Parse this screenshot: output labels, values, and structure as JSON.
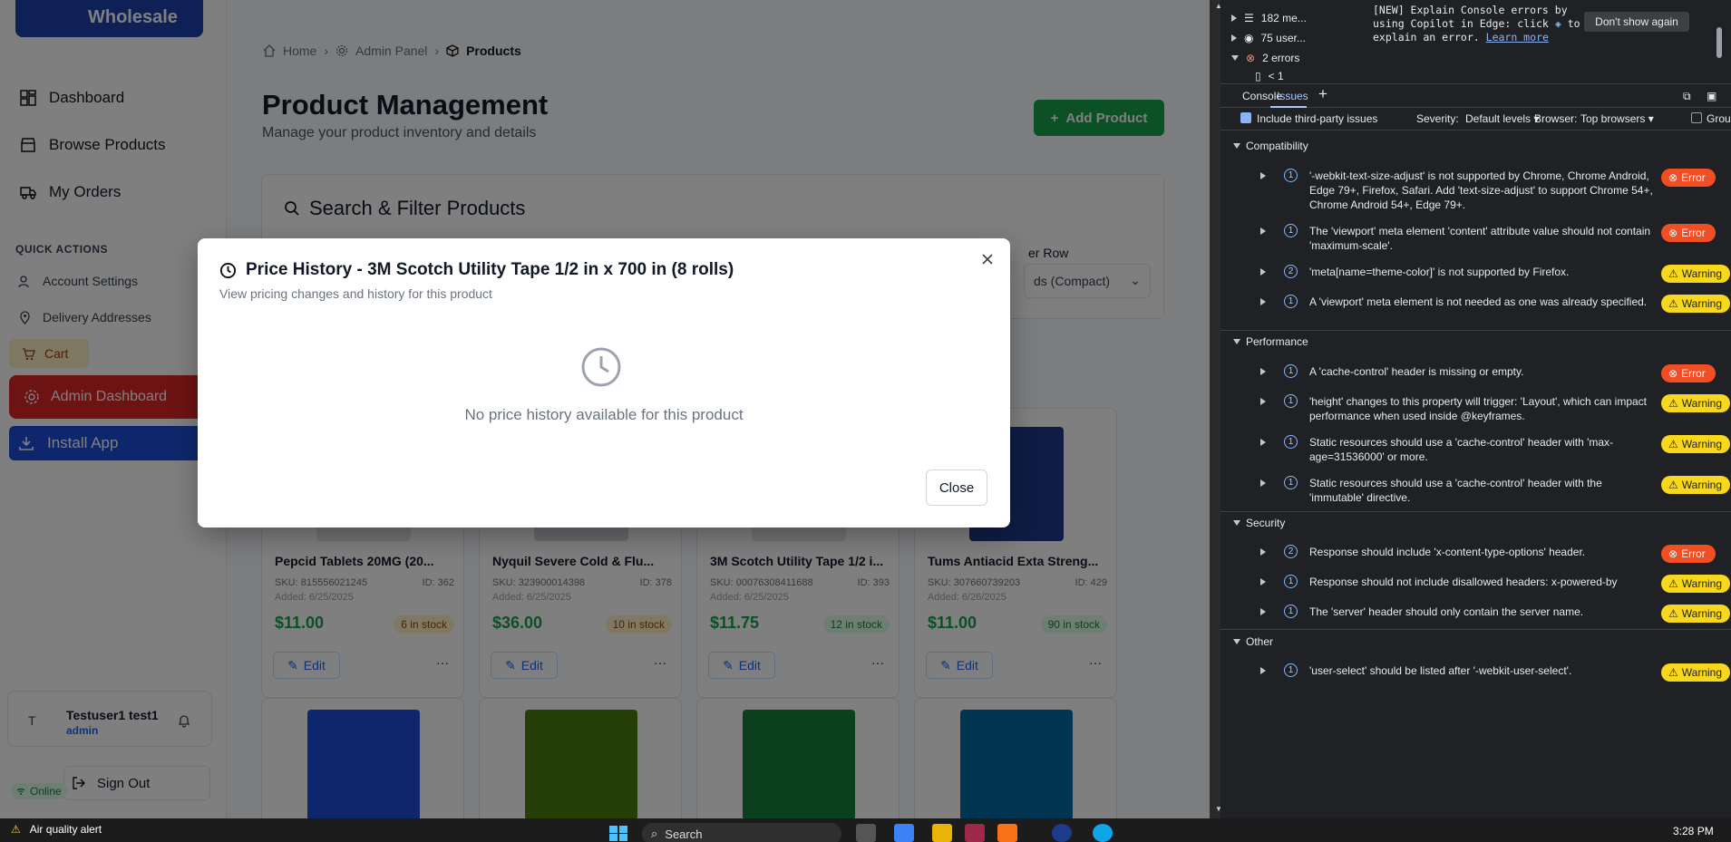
{
  "sidebar": {
    "brand": "Wholesale",
    "nav": [
      {
        "label": "Dashboard",
        "icon": "dashboard-icon"
      },
      {
        "label": "Browse Products",
        "icon": "store-icon"
      },
      {
        "label": "My Orders",
        "icon": "truck-icon"
      }
    ],
    "quick_actions_label": "QUICK ACTIONS",
    "quick_actions": [
      {
        "label": "Account Settings",
        "icon": "user-settings-icon"
      },
      {
        "label": "Delivery Addresses",
        "icon": "map-pin-icon"
      }
    ],
    "cart_label": "Cart",
    "admin_label": "Admin Dashboard",
    "install_label": "Install App",
    "user": {
      "initial": "T",
      "name": "Testuser1 test1",
      "role": "admin"
    },
    "online_label": "Online",
    "signout_label": "Sign Out"
  },
  "breadcrumb": {
    "home": "Home",
    "admin": "Admin Panel",
    "current": "Products"
  },
  "page": {
    "title": "Product Management",
    "subtitle": "Manage your product inventory and details",
    "add_button": "Add Product",
    "filter_title": "Search & Filter Products",
    "per_row_label": "er Row",
    "per_row_value": "ds (Compact)"
  },
  "products": [
    {
      "name": "Pepcid Tablets 20MG (20...",
      "sku": "SKU: 815556021245",
      "id": "ID: 362",
      "added": "Added: 6/25/2025",
      "price": "$11.00",
      "stock": "6 in stock",
      "stock_kind": "low"
    },
    {
      "name": "Nyquil Severe Cold & Flu...",
      "sku": "SKU: 323900014398",
      "id": "ID: 378",
      "added": "Added: 6/25/2025",
      "price": "$36.00",
      "stock": "10 in stock",
      "stock_kind": "low"
    },
    {
      "name": "3M Scotch Utility Tape 1/2 i...",
      "sku": "SKU: 00076308411688",
      "id": "ID: 393",
      "added": "Added: 6/25/2025",
      "price": "$11.75",
      "stock": "12 in stock",
      "stock_kind": "ok"
    },
    {
      "name": "Tums Antiacid Exta Streng...",
      "sku": "SKU: 307660739203",
      "id": "ID: 429",
      "added": "Added: 6/26/2025",
      "price": "$11.00",
      "stock": "90 in stock",
      "stock_kind": "ok"
    }
  ],
  "edit_label": "Edit",
  "more_label": "···",
  "modal": {
    "title": "Price History - 3M Scotch Utility Tape 1/2 in x 700 in (8 rolls)",
    "subtitle": "View pricing changes and history for this product",
    "empty": "No price history available for this product",
    "close": "Close"
  },
  "devtools": {
    "tree": [
      {
        "label": "182 me...",
        "icon": "list-icon"
      },
      {
        "label": "75 user...",
        "icon": "user-circle-icon"
      },
      {
        "label": "2 errors",
        "icon": "error-circle-icon"
      },
      {
        "label": "< 1",
        "icon": "file-icon"
      }
    ],
    "message_prefix": "[NEW] Explain Console errors by using Copilot in Edge: click",
    "message_mid": "to explain an error.",
    "message_link": "Learn more",
    "dont_show": "Don't show again",
    "tabs": [
      "Console",
      "Issues"
    ],
    "toolbar": {
      "third_party": "Include third-party issues",
      "severity_label": "Severity:",
      "severity_value": "Default levels",
      "browser_label": "Browser:",
      "browser_value": "Top browsers",
      "group": "Grou"
    },
    "categories": [
      {
        "name": "Compatibility",
        "issues": [
          {
            "count": "1",
            "text": "'-webkit-text-size-adjust' is not supported by Chrome, Chrome Android, Edge 79+, Firefox, Safari. Add 'text-size-adjust' to support Chrome 54+, Chrome Android 54+, Edge 79+.",
            "level": "Error"
          },
          {
            "count": "1",
            "text": "The 'viewport' meta element 'content' attribute value should not contain 'maximum-scale'.",
            "level": "Error"
          },
          {
            "count": "2",
            "text": "'meta[name=theme-color]' is not supported by Firefox.",
            "level": "Warning"
          },
          {
            "count": "1",
            "text": "A 'viewport' meta element is not needed as one was already specified.",
            "level": "Warning"
          }
        ]
      },
      {
        "name": "Performance",
        "issues": [
          {
            "count": "1",
            "text": "A 'cache-control' header is missing or empty.",
            "level": "Error"
          },
          {
            "count": "1",
            "text": "'height' changes to this property will trigger: 'Layout', which can impact performance when used inside @keyframes.",
            "level": "Warning"
          },
          {
            "count": "1",
            "text": "Static resources should use a 'cache-control' header with 'max-age=31536000' or more.",
            "level": "Warning"
          },
          {
            "count": "1",
            "text": "Static resources should use a 'cache-control' header with the 'immutable' directive.",
            "level": "Warning"
          }
        ]
      },
      {
        "name": "Security",
        "issues": [
          {
            "count": "2",
            "text": "Response should include 'x-content-type-options' header.",
            "level": "Error"
          },
          {
            "count": "1",
            "text": "Response should not include disallowed headers: x-powered-by",
            "level": "Warning"
          },
          {
            "count": "1",
            "text": "The 'server' header should only contain the server name.",
            "level": "Warning"
          }
        ]
      },
      {
        "name": "Other",
        "issues": [
          {
            "count": "1",
            "text": "'user-select' should be listed after '-webkit-user-select'.",
            "level": "Warning"
          }
        ]
      }
    ]
  },
  "taskbar": {
    "alert": "Air quality alert",
    "search": "Search",
    "time": "3:28 PM"
  },
  "colors": {
    "accent": "#1d4ed8",
    "admin": "#dc2626",
    "success": "#16a34a",
    "error_badge": "#f04e23",
    "warning_badge": "#f9d71c"
  }
}
